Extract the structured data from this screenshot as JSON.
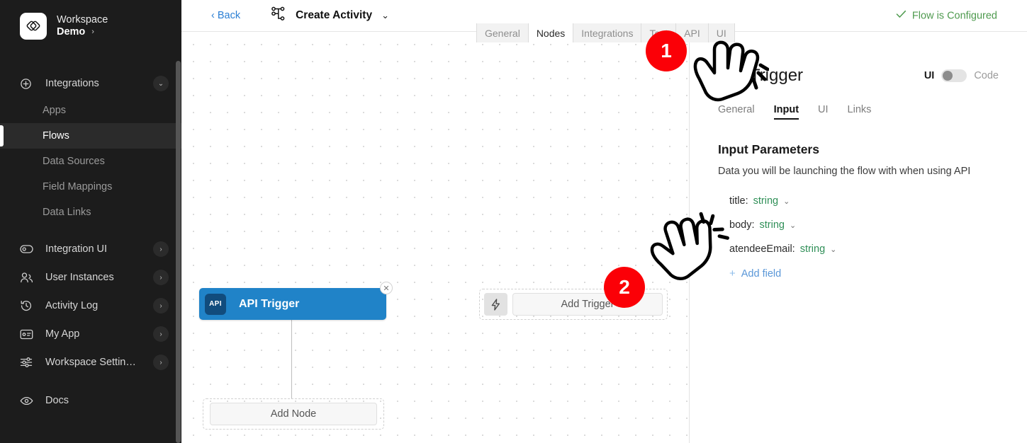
{
  "sidebar": {
    "workspace_label": "Workspace",
    "workspace_name": "Demo",
    "chevron": "›",
    "groups": [
      {
        "label": "Integrations",
        "icon": "plus-circle-icon",
        "caret": "⌄",
        "expanded": true,
        "items": [
          {
            "label": "Apps",
            "active": false
          },
          {
            "label": "Flows",
            "active": true
          },
          {
            "label": "Data Sources",
            "active": false
          },
          {
            "label": "Field Mappings",
            "active": false
          },
          {
            "label": "Data Links",
            "active": false
          }
        ]
      },
      {
        "label": "Integration UI",
        "icon": "toggle-icon",
        "caret": "›",
        "expanded": false,
        "items": []
      },
      {
        "label": "User Instances",
        "icon": "users-icon",
        "caret": "›",
        "expanded": false,
        "items": []
      },
      {
        "label": "Activity Log",
        "icon": "history-icon",
        "caret": "›",
        "expanded": false,
        "items": []
      },
      {
        "label": "My App",
        "icon": "id-card-icon",
        "caret": "›",
        "expanded": false,
        "items": []
      },
      {
        "label": "Workspace Settin…",
        "icon": "sliders-icon",
        "caret": "›",
        "expanded": false,
        "items": []
      },
      {
        "label": "Docs",
        "icon": "eye-icon",
        "caret": "",
        "expanded": false,
        "items": []
      }
    ]
  },
  "topbar": {
    "back_label": "‹ Back",
    "activity_title": "Create Activity",
    "activity_caret": "⌄",
    "activity_icon": "flow-tree-icon",
    "flow_status": "Flow is Configured",
    "flow_status_icon": "check-icon",
    "flow_status_color": "#4e9a4e"
  },
  "flow_tabs": [
    {
      "label": "General",
      "active": false
    },
    {
      "label": "Nodes",
      "active": true
    },
    {
      "label": "Integrations",
      "active": false
    },
    {
      "label": "Test",
      "active": false
    },
    {
      "label": "API",
      "active": false
    },
    {
      "label": "UI",
      "active": false
    }
  ],
  "canvas": {
    "api_node": {
      "badge": "API",
      "label": "API Trigger",
      "close_icon": "close-icon",
      "color": "#2083c8"
    },
    "add_node_label": "Add Node",
    "add_trigger_label": "Add Trigger",
    "bolt_icon": "lightning-bolt-icon"
  },
  "panel": {
    "title": "API Trigger",
    "toggle_left_label": "UI",
    "toggle_right_label": "Code",
    "tabs": [
      {
        "label": "General",
        "active": false
      },
      {
        "label": "Input",
        "active": true
      },
      {
        "label": "UI",
        "active": false
      },
      {
        "label": "Links",
        "active": false
      }
    ],
    "section_title": "Input Parameters",
    "section_desc": "Data you will be launching the flow with when using API",
    "fields": [
      {
        "key": "title",
        "type": "string",
        "caret": "⌄"
      },
      {
        "key": "body",
        "type": "string",
        "caret": "⌄"
      },
      {
        "key": "atendeeEmail",
        "type": "string",
        "caret": "⌄"
      }
    ],
    "add_field_label": "Add field",
    "add_field_plus": "+"
  },
  "annotations": {
    "badges": [
      {
        "number": "1"
      },
      {
        "number": "2"
      }
    ],
    "cursor_icon": "pointing-hand-cursor"
  }
}
